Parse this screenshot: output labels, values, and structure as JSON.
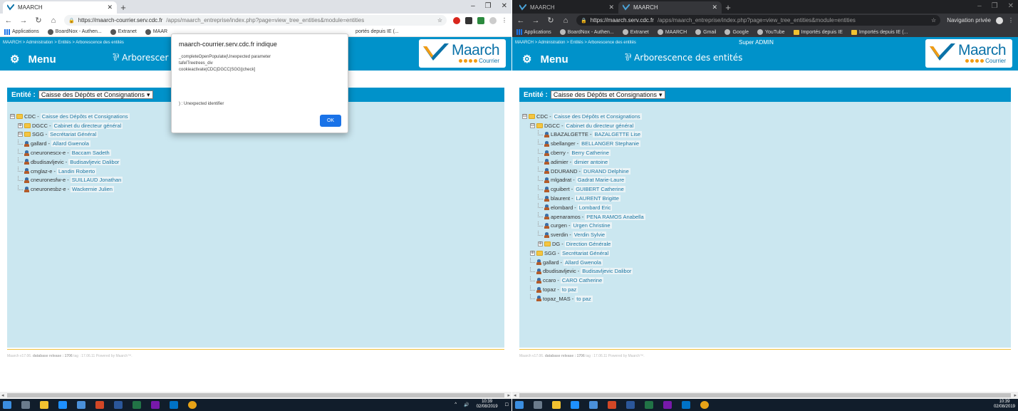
{
  "left": {
    "tab_title": "MAARCH",
    "url_host": "https://maarch-courrier.serv.cdc.fr",
    "url_path": "/apps/maarch_entreprise/index.php?page=view_tree_entities&module=entities",
    "bookmarks": [
      "Applications",
      "BoardNox - Authen...",
      "Extranet",
      "MAAR",
      "portés depuis IE (..."
    ],
    "crumbs": "MAARCH > Administration > Entités > Arborescence des entités",
    "menu_label": "Menu",
    "page_title": "Arborescer",
    "entity_label": "Entité :",
    "entity_value": "Caisse des Dépôts et Consignations",
    "tree": [
      {
        "level": 0,
        "type": "folder",
        "toggle": "⊟",
        "code": "CDC",
        "name": "Caisse des Dépôts et Consignations"
      },
      {
        "level": 1,
        "type": "folder",
        "toggle": "⊕",
        "code": "DGCC",
        "name": "Cabinet du directeur général"
      },
      {
        "level": 1,
        "type": "folder",
        "toggle": "⊟",
        "code": "SGG",
        "name": "Secrétariat Général"
      },
      {
        "level": 1,
        "type": "user",
        "code": "gallard",
        "name": "Allard Gwenola"
      },
      {
        "level": 1,
        "type": "user",
        "code": "cneuronescx-e",
        "name": "Baccam Sadeth"
      },
      {
        "level": 1,
        "type": "user",
        "code": "dbudisavljevic",
        "name": "Budisavljevic Dalibor"
      },
      {
        "level": 1,
        "type": "user",
        "code": "cmglaz-e",
        "name": "Landin Roberto"
      },
      {
        "level": 1,
        "type": "user",
        "code": "cneuronesfw-e",
        "name": "SUILLAUD Jonathan"
      },
      {
        "level": 1,
        "type": "user",
        "code": "cneuronesbz-e",
        "name": "Wackernie Julien"
      }
    ],
    "footer_prefix": "Maarch v17.06.",
    "footer_bold": "database release : 1706",
    "footer_suffix": "tag : 17.06.11 Powered by Maarch™.",
    "dialog": {
      "title": "maarch-courrier.serv.cdc.fr indique",
      "message": "_completeOpenPopulate(Unexpected parameter\ntafelTreetrees_div\ncookieactivate|CDC|DGCC|SGG||check]",
      "message2": ") : Unexpected identifier",
      "ok_label": "OK"
    },
    "clock_time": "10:39",
    "clock_date": "02/08/2019"
  },
  "right": {
    "tab1_title": "MAARCH",
    "tab2_title": "MAARCH",
    "url_host": "https://maarch.serv.cdc.fr",
    "url_path": "/apps/maarch_entreprise/index.php?page=view_tree_entities&module=entities",
    "private_label": "Navigation privée",
    "bookmarks": [
      "Applications",
      "BoardNox - Authen...",
      "Extranet",
      "MAARCH",
      "Gmail",
      "Google",
      "YouTube",
      "Importés depuis IE",
      "Importés depuis IE (..."
    ],
    "crumbs": "MAARCH > Administration > Entités > Arborescence des entités",
    "user_label": "Super ADMIN",
    "menu_label": "Menu",
    "page_title": "Arborescence des entités",
    "entity_label": "Entité :",
    "entity_value": "Caisse des Dépôts et Consignations",
    "tree": [
      {
        "level": 0,
        "type": "folder",
        "toggle": "⊟",
        "code": "CDC",
        "name": "Caisse des Dépôts et Consignations"
      },
      {
        "level": 1,
        "type": "folder",
        "toggle": "⊟",
        "code": "DGCC",
        "name": "Cabinet du directeur général"
      },
      {
        "level": 2,
        "type": "user",
        "code": "LBAZALGETTE",
        "name": "BAZALGETTE Lise"
      },
      {
        "level": 2,
        "type": "user",
        "code": "sbellanger",
        "name": "BELLANGER Stephanie"
      },
      {
        "level": 2,
        "type": "user",
        "code": "cberry",
        "name": "Berry Catherine"
      },
      {
        "level": 2,
        "type": "user",
        "code": "adimier",
        "name": "dimier antoine"
      },
      {
        "level": 2,
        "type": "user",
        "code": "DDURAND",
        "name": "DURAND Delphine"
      },
      {
        "level": 2,
        "type": "user",
        "code": "mlgadrat",
        "name": "Gadrat Marie-Laure"
      },
      {
        "level": 2,
        "type": "user",
        "code": "cguibert",
        "name": "GUIBERT Catherine"
      },
      {
        "level": 2,
        "type": "user",
        "code": "blaurent",
        "name": "LAURENT Brigitte"
      },
      {
        "level": 2,
        "type": "user",
        "code": "elombard",
        "name": "Lombard Eric"
      },
      {
        "level": 2,
        "type": "user",
        "code": "apenaramos",
        "name": "PENA RAMOS Anabella"
      },
      {
        "level": 2,
        "type": "user",
        "code": "curgen",
        "name": "Urgen Christine"
      },
      {
        "level": 2,
        "type": "user",
        "code": "sverdin",
        "name": "Verdin Sylvie"
      },
      {
        "level": 2,
        "type": "folder",
        "toggle": "⊕",
        "code": "DG",
        "name": "Direction Générale"
      },
      {
        "level": 1,
        "type": "folder",
        "toggle": "⊕",
        "code": "SGG",
        "name": "Secrétariat Général"
      },
      {
        "level": 1,
        "type": "user",
        "code": "gallard",
        "name": "Allard Gwenola"
      },
      {
        "level": 1,
        "type": "user",
        "code": "dbudisavljevic",
        "name": "Budisavljevic Dalibor"
      },
      {
        "level": 1,
        "type": "user",
        "code": "ccaro",
        "name": "CARO Catherine"
      },
      {
        "level": 1,
        "type": "user",
        "code": "topaz",
        "name": "to paz"
      },
      {
        "level": 1,
        "type": "user",
        "code": "topaz_MAS",
        "name": "to paz"
      }
    ],
    "footer_prefix": "Maarch v17.06.",
    "footer_bold": "database release : 1706",
    "footer_suffix": "tag : 17.06.11 Powered by Maarch™.",
    "clock_time": "10:39",
    "clock_date": "02/08/2019"
  },
  "logo": {
    "name": "Maarch",
    "sub": "Courrier"
  },
  "colors": {
    "header": "#0092ca",
    "content": "#cbe7f0",
    "footer_rule": "#f0c040",
    "dialog_button": "#1a73e8"
  },
  "icons": {
    "menu": "settings-gear-icon",
    "page": "tree-icon",
    "folder": "folder-icon",
    "user": "user-icon"
  }
}
